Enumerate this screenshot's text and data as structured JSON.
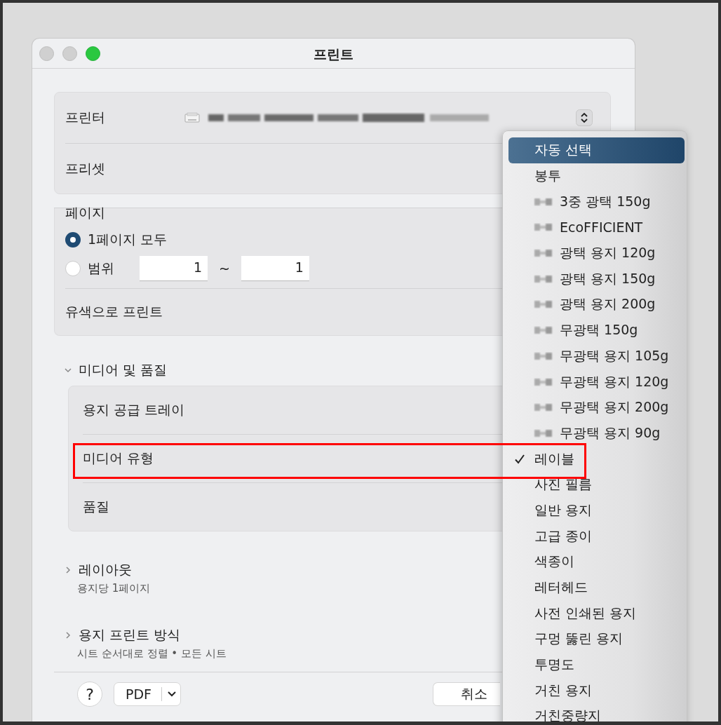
{
  "window": {
    "title": "프린트"
  },
  "printer": {
    "label": "프린터"
  },
  "preset": {
    "label": "프리셋"
  },
  "pages": {
    "label": "페이지",
    "options": [
      {
        "label": "1페이지 모두",
        "selected": true
      },
      {
        "label": "범위",
        "selected": false
      }
    ],
    "range_from": "1",
    "range_separator": "~",
    "range_to": "1"
  },
  "color_print": {
    "label": "유색으로 프린트"
  },
  "sections": [
    {
      "title": "미디어 및 품질",
      "expanded": true,
      "rows": [
        "용지 공급 트레이",
        "미디어 유형",
        "품질"
      ]
    },
    {
      "title": "레이아웃",
      "expanded": false,
      "summary": "용지당 1페이지"
    },
    {
      "title": "용지 프린트 방식",
      "expanded": false,
      "summary": "시트 순서대로 정렬 • 모든 시트"
    }
  ],
  "footer": {
    "help": "?",
    "pdf": "PDF",
    "cancel": "취소"
  },
  "media_menu": {
    "items": [
      {
        "label": "자동 선택",
        "selected": true,
        "checked": false,
        "redacted": false
      },
      {
        "label": "봉투",
        "selected": false,
        "checked": false,
        "redacted": false
      },
      {
        "label": "3중 광택 150g",
        "selected": false,
        "checked": false,
        "redacted": true
      },
      {
        "label": "EcoFFICIENT",
        "selected": false,
        "checked": false,
        "redacted": true
      },
      {
        "label": "광택 용지 120g",
        "selected": false,
        "checked": false,
        "redacted": true
      },
      {
        "label": "광택 용지 150g",
        "selected": false,
        "checked": false,
        "redacted": true
      },
      {
        "label": "광택 용지 200g",
        "selected": false,
        "checked": false,
        "redacted": true
      },
      {
        "label": "무광택 150g",
        "selected": false,
        "checked": false,
        "redacted": true
      },
      {
        "label": "무광택 용지 105g",
        "selected": false,
        "checked": false,
        "redacted": true
      },
      {
        "label": "무광택 용지 120g",
        "selected": false,
        "checked": false,
        "redacted": true
      },
      {
        "label": "무광택 용지 200g",
        "selected": false,
        "checked": false,
        "redacted": true
      },
      {
        "label": "무광택 용지 90g",
        "selected": false,
        "checked": false,
        "redacted": true
      },
      {
        "label": "레이블",
        "selected": false,
        "checked": true,
        "redacted": false
      },
      {
        "label": "사진 필름",
        "selected": false,
        "checked": false,
        "redacted": false
      },
      {
        "label": "일반 용지",
        "selected": false,
        "checked": false,
        "redacted": false
      },
      {
        "label": "고급 종이",
        "selected": false,
        "checked": false,
        "redacted": false
      },
      {
        "label": "색종이",
        "selected": false,
        "checked": false,
        "redacted": false
      },
      {
        "label": "레터헤드",
        "selected": false,
        "checked": false,
        "redacted": false
      },
      {
        "label": "사전 인쇄된 용지",
        "selected": false,
        "checked": false,
        "redacted": false
      },
      {
        "label": "구멍 뚫린 용지",
        "selected": false,
        "checked": false,
        "redacted": false
      },
      {
        "label": "투명도",
        "selected": false,
        "checked": false,
        "redacted": false
      },
      {
        "label": "거친 용지",
        "selected": false,
        "checked": false,
        "redacted": false
      },
      {
        "label": "거친중량지",
        "selected": false,
        "checked": false,
        "redacted": false
      }
    ]
  }
}
